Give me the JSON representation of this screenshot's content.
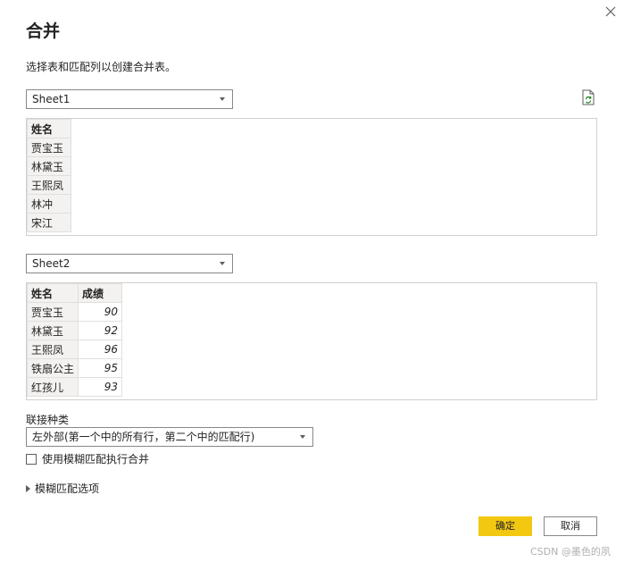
{
  "dialog": {
    "title": "合并",
    "subtitle": "选择表和匹配列以创建合并表。"
  },
  "table1": {
    "select_value": "Sheet1",
    "headers": [
      "姓名"
    ],
    "rows": [
      "贾宝玉",
      "林黛玉",
      "王熙凤",
      "林冲",
      "宋江"
    ]
  },
  "table2": {
    "select_value": "Sheet2",
    "headers": [
      "姓名",
      "成绩"
    ],
    "rows": [
      {
        "name": "贾宝玉",
        "score": "90"
      },
      {
        "name": "林黛玉",
        "score": "92"
      },
      {
        "name": "王熙凤",
        "score": "96"
      },
      {
        "name": "铁扇公主",
        "score": "95"
      },
      {
        "name": "红孩儿",
        "score": "93"
      }
    ]
  },
  "join": {
    "label": "联接种类",
    "value": "左外部(第一个中的所有行，第二个中的匹配行)"
  },
  "fuzzy": {
    "checkbox_label": "使用模糊匹配执行合并",
    "checked": false,
    "options_label": "模糊匹配选项"
  },
  "buttons": {
    "ok": "确定",
    "cancel": "取消"
  },
  "watermark": "CSDN @墨色的夙",
  "colors": {
    "accent": "#f2c811",
    "header_bg": "#f3f2f1",
    "border": "#8a8886"
  },
  "icons": {
    "close": "close-icon",
    "refresh": "refresh-icon",
    "dropdown": "chevron-down-icon",
    "expand": "caret-right-icon"
  }
}
